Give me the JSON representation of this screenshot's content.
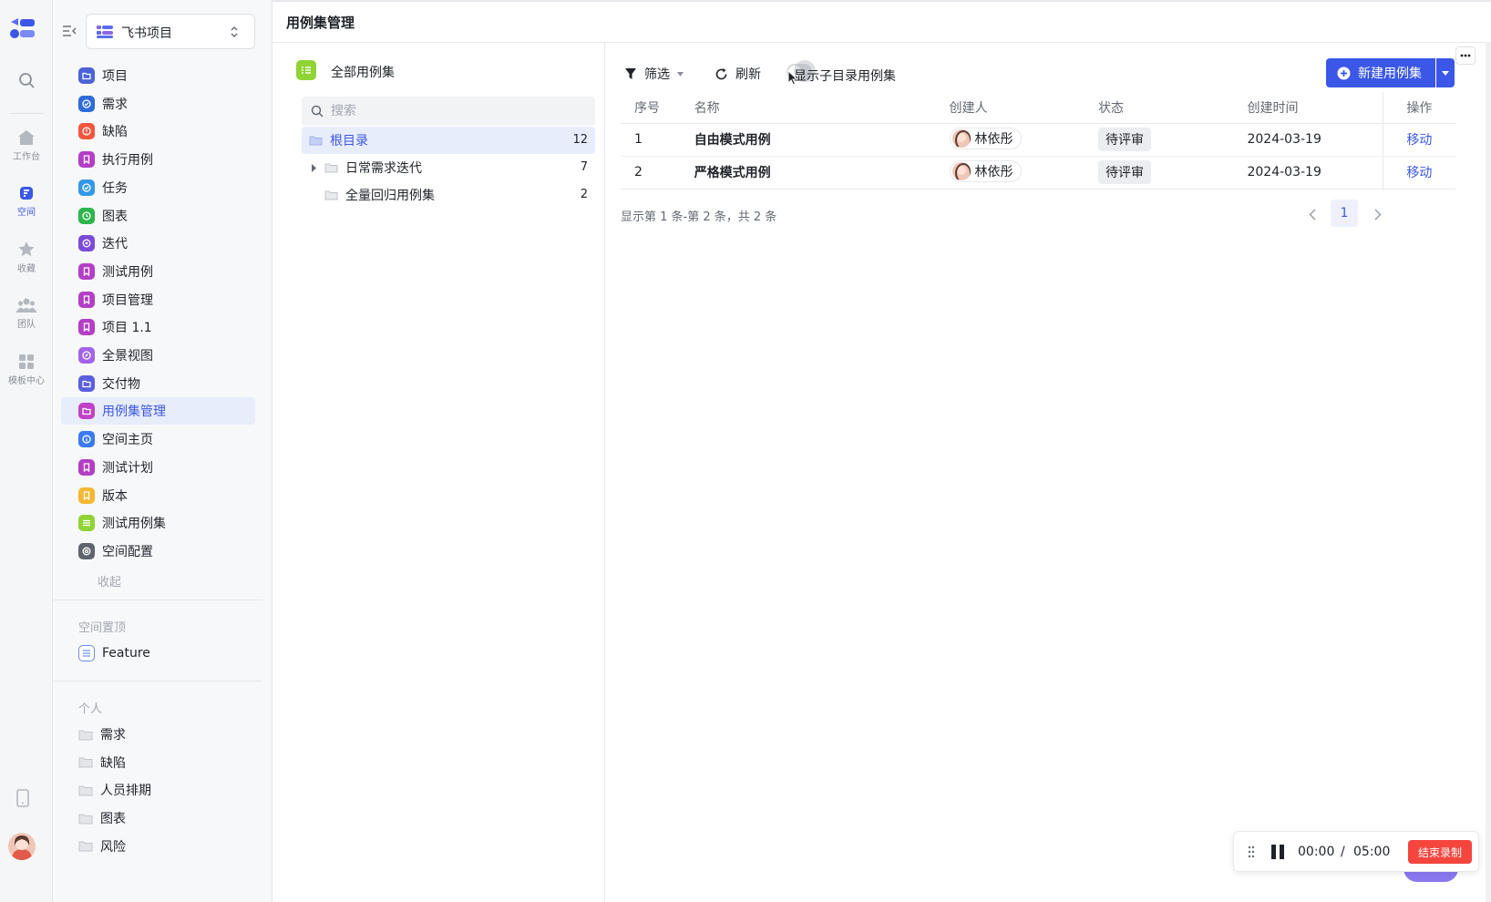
{
  "rail": {
    "items": [
      {
        "label": ""
      },
      {
        "label": "工作台"
      },
      {
        "label": "空间"
      },
      {
        "label": "收藏"
      },
      {
        "label": "团队"
      },
      {
        "label": "模板中心"
      }
    ]
  },
  "nav": {
    "project_name": "飞书项目",
    "items": [
      {
        "label": "项目",
        "color": "#4a63d8"
      },
      {
        "label": "需求",
        "color": "#2f6bd8"
      },
      {
        "label": "缺陷",
        "color": "#f5553f"
      },
      {
        "label": "执行用例",
        "color": "#b43ec6"
      },
      {
        "label": "任务",
        "color": "#3498e8"
      },
      {
        "label": "图表",
        "color": "#2bb54a"
      },
      {
        "label": "迭代",
        "color": "#7a4bd8"
      },
      {
        "label": "测试用例",
        "color": "#b43ec6"
      },
      {
        "label": "项目管理",
        "color": "#b43ec6"
      },
      {
        "label": "项目 1.1",
        "color": "#b43ec6"
      },
      {
        "label": "全景视图",
        "color": "#a363e8"
      },
      {
        "label": "交付物",
        "color": "#5a5ee0"
      },
      {
        "label": "用例集管理",
        "color": "#c041c8"
      },
      {
        "label": "空间主页",
        "color": "#3a7af0"
      },
      {
        "label": "测试计划",
        "color": "#b43ec6"
      },
      {
        "label": "版本",
        "color": "#f5b731"
      },
      {
        "label": "测试用例集",
        "color": "#8fd434"
      },
      {
        "label": "空间配置",
        "color": "#5f656e"
      }
    ],
    "collapse_label": "收起",
    "pinned_section": "空间置顶",
    "pinned_items": [
      {
        "label": "Feature"
      }
    ],
    "personal_section": "个人",
    "personal_items": [
      {
        "label": "需求"
      },
      {
        "label": "缺陷"
      },
      {
        "label": "人员排期"
      },
      {
        "label": "图表"
      },
      {
        "label": "风险"
      }
    ]
  },
  "header": {
    "title": "用例集管理"
  },
  "tree": {
    "root_label": "全部用例集",
    "search_placeholder": "搜索",
    "rows": [
      {
        "label": "根目录",
        "count": "12"
      },
      {
        "label": "日常需求迭代",
        "count": "7"
      },
      {
        "label": "全量回归用例集",
        "count": "2"
      }
    ]
  },
  "toolbar": {
    "filter_label": "筛选",
    "refresh_label": "刷新",
    "toggle_label": "显示子目录用例集",
    "new_label": "新建用例集"
  },
  "table": {
    "headers": [
      "序号",
      "名称",
      "创建人",
      "状态",
      "创建时间",
      "操作"
    ],
    "rows": [
      {
        "index": "1",
        "name": "自由模式用例",
        "creator": "林依彤",
        "status": "待评审",
        "created": "2024-03-19",
        "action": "移动"
      },
      {
        "index": "2",
        "name": "严格模式用例",
        "creator": "林依彤",
        "status": "待评审",
        "created": "2024-03-19",
        "action": "移动"
      }
    ]
  },
  "pager": {
    "summary": "显示第 1 条-第 2 条，共 2 条",
    "current": "1"
  },
  "recording": {
    "elapsed": "00:00",
    "separator": "/",
    "total": "05:00",
    "stop_label": "结束录制"
  }
}
